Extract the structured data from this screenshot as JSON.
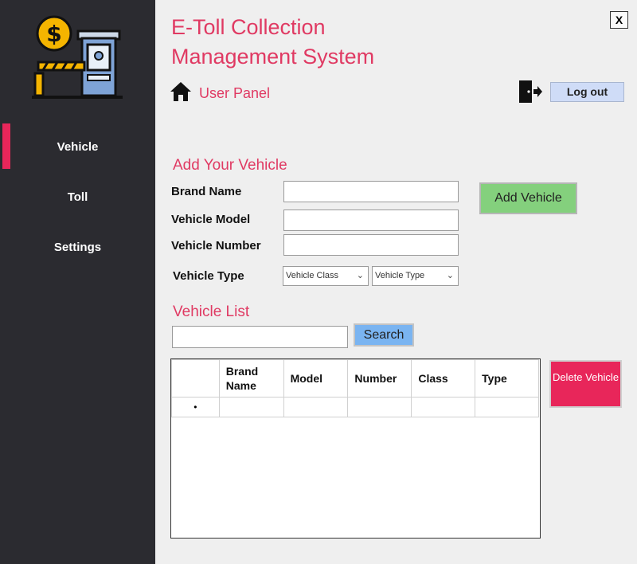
{
  "header": {
    "title_line1": "E-Toll Collection",
    "title_line2": "Management System",
    "panel_label": "User Panel",
    "close_label": "X",
    "logout_label": "Log out"
  },
  "sidebar": {
    "items": [
      {
        "label": "Vehicle",
        "active": true
      },
      {
        "label": "Toll",
        "active": false
      },
      {
        "label": "Settings",
        "active": false
      }
    ],
    "accent_color": "#e8265a"
  },
  "add_vehicle": {
    "title": "Add Your Vehicle",
    "brand_label": "Brand Name",
    "model_label": "Vehicle Model",
    "number_label": "Vehicle Number",
    "type_label": "Vehicle Type",
    "class_select": "Vehicle Class",
    "type_select": "Vehicle Type",
    "add_button": "Add Vehicle"
  },
  "vehicle_list": {
    "title": "Vehicle List",
    "search_button": "Search",
    "columns": [
      "Brand Name",
      "Model",
      "Number",
      "Class",
      "Type"
    ],
    "new_row_marker": "•",
    "delete_button": "Delete Vehicle"
  },
  "icons": {
    "logo": "toll-booth-icon",
    "home": "home-icon",
    "logout": "exit-door-icon"
  }
}
